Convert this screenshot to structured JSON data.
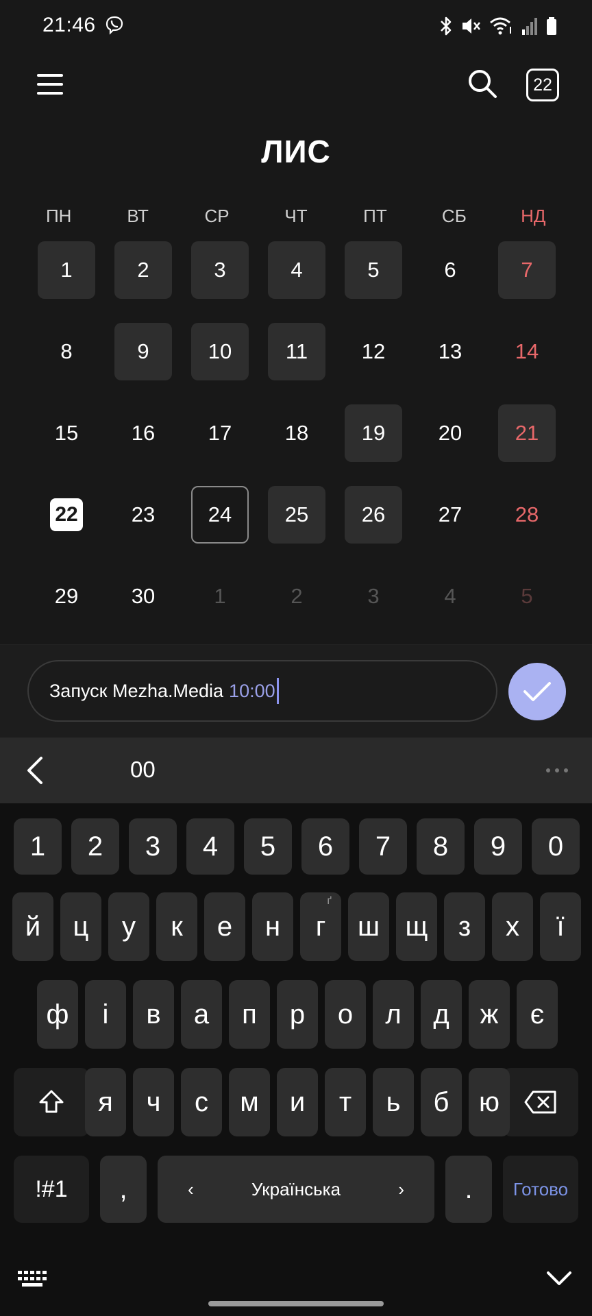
{
  "status_bar": {
    "time": "21:46"
  },
  "header": {
    "today_badge": "22",
    "month_title": "ЛИС"
  },
  "calendar": {
    "weekdays": [
      "ПН",
      "ВТ",
      "СР",
      "ЧТ",
      "ПТ",
      "СБ",
      "НД"
    ],
    "days": [
      {
        "label": "1",
        "event": true
      },
      {
        "label": "2",
        "event": true
      },
      {
        "label": "3",
        "event": true
      },
      {
        "label": "4",
        "event": true
      },
      {
        "label": "5",
        "event": true
      },
      {
        "label": "6"
      },
      {
        "label": "7",
        "event": true,
        "sunday": true
      },
      {
        "label": "8"
      },
      {
        "label": "9",
        "event": true
      },
      {
        "label": "10",
        "event": true
      },
      {
        "label": "11",
        "event": true
      },
      {
        "label": "12"
      },
      {
        "label": "13"
      },
      {
        "label": "14",
        "sunday": true
      },
      {
        "label": "15"
      },
      {
        "label": "16"
      },
      {
        "label": "17"
      },
      {
        "label": "18"
      },
      {
        "label": "19",
        "event": true
      },
      {
        "label": "20"
      },
      {
        "label": "21",
        "event": true,
        "sunday": true
      },
      {
        "label": "22",
        "today": true
      },
      {
        "label": "23"
      },
      {
        "label": "24",
        "selected": true
      },
      {
        "label": "25",
        "event": true
      },
      {
        "label": "26",
        "event": true
      },
      {
        "label": "27"
      },
      {
        "label": "28",
        "sunday": true
      },
      {
        "label": "29"
      },
      {
        "label": "30"
      },
      {
        "label": "1",
        "other": true
      },
      {
        "label": "2",
        "other": true
      },
      {
        "label": "3",
        "other": true
      },
      {
        "label": "4",
        "other": true
      },
      {
        "label": "5",
        "other": true,
        "sunday": true
      }
    ]
  },
  "input": {
    "text": "Запуск Mezha.Media",
    "time": "10:00"
  },
  "suggestion_bar": {
    "suggestion": "00"
  },
  "keyboard": {
    "row_numbers": [
      "1",
      "2",
      "3",
      "4",
      "5",
      "6",
      "7",
      "8",
      "9",
      "0"
    ],
    "row_1": [
      "й",
      "ц",
      "у",
      "к",
      "е",
      "н",
      "г",
      "ш",
      "щ",
      "з",
      "х",
      "ї"
    ],
    "row_1_hint": "ґ",
    "row_2": [
      "ф",
      "і",
      "в",
      "а",
      "п",
      "р",
      "о",
      "л",
      "д",
      "ж",
      "є"
    ],
    "row_3": [
      "я",
      "ч",
      "с",
      "м",
      "и",
      "т",
      "ь",
      "б",
      "ю"
    ],
    "symbols_label": "!#1",
    "comma_label": ",",
    "space_label": "Українська",
    "space_left": "‹",
    "space_right": "›",
    "period_label": ".",
    "done_label": "Готово"
  },
  "colors": {
    "accent": "#aab2f2",
    "sunday": "#e8686a",
    "done": "#7c93e6"
  }
}
